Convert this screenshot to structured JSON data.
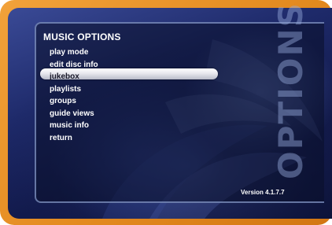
{
  "menu": {
    "title": "MUSIC OPTIONS",
    "items": [
      {
        "label": "play mode"
      },
      {
        "label": "edit disc info"
      },
      {
        "label": "jukebox"
      },
      {
        "label": "playlists"
      },
      {
        "label": "groups"
      },
      {
        "label": "guide views"
      },
      {
        "label": "music info"
      },
      {
        "label": "return"
      }
    ],
    "selected_item": "jukebox"
  },
  "side_label": "OPTIONS",
  "version": "Version 4.1.7.7",
  "colors": {
    "frame": "#e38a1f",
    "background": "#1e2a6a",
    "highlight": "#e8e8ee",
    "text": "#ffffff"
  }
}
